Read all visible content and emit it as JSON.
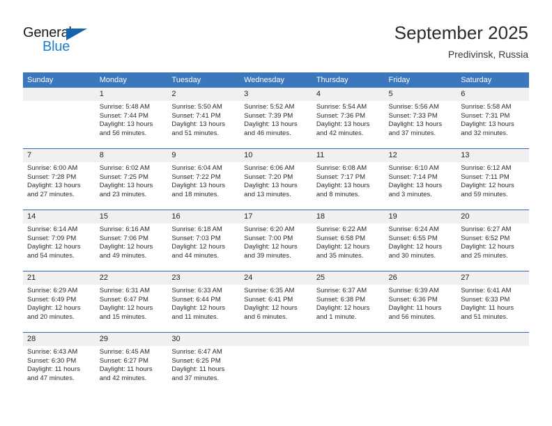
{
  "brand": {
    "name_part1": "General",
    "name_part2": "Blue",
    "triangle_color": "#1463ad",
    "blue_color": "#1d7fd0"
  },
  "header": {
    "title": "September 2025",
    "location": "Predivinsk, Russia"
  },
  "theme": {
    "header_blue": "#3a77bd",
    "row_divider": "#2f6bb0",
    "daynum_bg": "#f0f0f0"
  },
  "weekday_headers": [
    "Sunday",
    "Monday",
    "Tuesday",
    "Wednesday",
    "Thursday",
    "Friday",
    "Saturday"
  ],
  "weeks": [
    [
      {
        "day": "",
        "sunrise": "",
        "sunset": "",
        "daylight": "",
        "empty": true
      },
      {
        "day": "1",
        "sunrise": "Sunrise: 5:48 AM",
        "sunset": "Sunset: 7:44 PM",
        "daylight": "Daylight: 13 hours and 56 minutes."
      },
      {
        "day": "2",
        "sunrise": "Sunrise: 5:50 AM",
        "sunset": "Sunset: 7:41 PM",
        "daylight": "Daylight: 13 hours and 51 minutes."
      },
      {
        "day": "3",
        "sunrise": "Sunrise: 5:52 AM",
        "sunset": "Sunset: 7:39 PM",
        "daylight": "Daylight: 13 hours and 46 minutes."
      },
      {
        "day": "4",
        "sunrise": "Sunrise: 5:54 AM",
        "sunset": "Sunset: 7:36 PM",
        "daylight": "Daylight: 13 hours and 42 minutes."
      },
      {
        "day": "5",
        "sunrise": "Sunrise: 5:56 AM",
        "sunset": "Sunset: 7:33 PM",
        "daylight": "Daylight: 13 hours and 37 minutes."
      },
      {
        "day": "6",
        "sunrise": "Sunrise: 5:58 AM",
        "sunset": "Sunset: 7:31 PM",
        "daylight": "Daylight: 13 hours and 32 minutes."
      }
    ],
    [
      {
        "day": "7",
        "sunrise": "Sunrise: 6:00 AM",
        "sunset": "Sunset: 7:28 PM",
        "daylight": "Daylight: 13 hours and 27 minutes."
      },
      {
        "day": "8",
        "sunrise": "Sunrise: 6:02 AM",
        "sunset": "Sunset: 7:25 PM",
        "daylight": "Daylight: 13 hours and 23 minutes."
      },
      {
        "day": "9",
        "sunrise": "Sunrise: 6:04 AM",
        "sunset": "Sunset: 7:22 PM",
        "daylight": "Daylight: 13 hours and 18 minutes."
      },
      {
        "day": "10",
        "sunrise": "Sunrise: 6:06 AM",
        "sunset": "Sunset: 7:20 PM",
        "daylight": "Daylight: 13 hours and 13 minutes."
      },
      {
        "day": "11",
        "sunrise": "Sunrise: 6:08 AM",
        "sunset": "Sunset: 7:17 PM",
        "daylight": "Daylight: 13 hours and 8 minutes."
      },
      {
        "day": "12",
        "sunrise": "Sunrise: 6:10 AM",
        "sunset": "Sunset: 7:14 PM",
        "daylight": "Daylight: 13 hours and 3 minutes."
      },
      {
        "day": "13",
        "sunrise": "Sunrise: 6:12 AM",
        "sunset": "Sunset: 7:11 PM",
        "daylight": "Daylight: 12 hours and 59 minutes."
      }
    ],
    [
      {
        "day": "14",
        "sunrise": "Sunrise: 6:14 AM",
        "sunset": "Sunset: 7:09 PM",
        "daylight": "Daylight: 12 hours and 54 minutes."
      },
      {
        "day": "15",
        "sunrise": "Sunrise: 6:16 AM",
        "sunset": "Sunset: 7:06 PM",
        "daylight": "Daylight: 12 hours and 49 minutes."
      },
      {
        "day": "16",
        "sunrise": "Sunrise: 6:18 AM",
        "sunset": "Sunset: 7:03 PM",
        "daylight": "Daylight: 12 hours and 44 minutes."
      },
      {
        "day": "17",
        "sunrise": "Sunrise: 6:20 AM",
        "sunset": "Sunset: 7:00 PM",
        "daylight": "Daylight: 12 hours and 39 minutes."
      },
      {
        "day": "18",
        "sunrise": "Sunrise: 6:22 AM",
        "sunset": "Sunset: 6:58 PM",
        "daylight": "Daylight: 12 hours and 35 minutes."
      },
      {
        "day": "19",
        "sunrise": "Sunrise: 6:24 AM",
        "sunset": "Sunset: 6:55 PM",
        "daylight": "Daylight: 12 hours and 30 minutes."
      },
      {
        "day": "20",
        "sunrise": "Sunrise: 6:27 AM",
        "sunset": "Sunset: 6:52 PM",
        "daylight": "Daylight: 12 hours and 25 minutes."
      }
    ],
    [
      {
        "day": "21",
        "sunrise": "Sunrise: 6:29 AM",
        "sunset": "Sunset: 6:49 PM",
        "daylight": "Daylight: 12 hours and 20 minutes."
      },
      {
        "day": "22",
        "sunrise": "Sunrise: 6:31 AM",
        "sunset": "Sunset: 6:47 PM",
        "daylight": "Daylight: 12 hours and 15 minutes."
      },
      {
        "day": "23",
        "sunrise": "Sunrise: 6:33 AM",
        "sunset": "Sunset: 6:44 PM",
        "daylight": "Daylight: 12 hours and 11 minutes."
      },
      {
        "day": "24",
        "sunrise": "Sunrise: 6:35 AM",
        "sunset": "Sunset: 6:41 PM",
        "daylight": "Daylight: 12 hours and 6 minutes."
      },
      {
        "day": "25",
        "sunrise": "Sunrise: 6:37 AM",
        "sunset": "Sunset: 6:38 PM",
        "daylight": "Daylight: 12 hours and 1 minute."
      },
      {
        "day": "26",
        "sunrise": "Sunrise: 6:39 AM",
        "sunset": "Sunset: 6:36 PM",
        "daylight": "Daylight: 11 hours and 56 minutes."
      },
      {
        "day": "27",
        "sunrise": "Sunrise: 6:41 AM",
        "sunset": "Sunset: 6:33 PM",
        "daylight": "Daylight: 11 hours and 51 minutes."
      }
    ],
    [
      {
        "day": "28",
        "sunrise": "Sunrise: 6:43 AM",
        "sunset": "Sunset: 6:30 PM",
        "daylight": "Daylight: 11 hours and 47 minutes."
      },
      {
        "day": "29",
        "sunrise": "Sunrise: 6:45 AM",
        "sunset": "Sunset: 6:27 PM",
        "daylight": "Daylight: 11 hours and 42 minutes."
      },
      {
        "day": "30",
        "sunrise": "Sunrise: 6:47 AM",
        "sunset": "Sunset: 6:25 PM",
        "daylight": "Daylight: 11 hours and 37 minutes."
      },
      {
        "day": "",
        "sunrise": "",
        "sunset": "",
        "daylight": "",
        "empty": true
      },
      {
        "day": "",
        "sunrise": "",
        "sunset": "",
        "daylight": "",
        "empty": true
      },
      {
        "day": "",
        "sunrise": "",
        "sunset": "",
        "daylight": "",
        "empty": true
      },
      {
        "day": "",
        "sunrise": "",
        "sunset": "",
        "daylight": "",
        "empty": true
      }
    ]
  ]
}
